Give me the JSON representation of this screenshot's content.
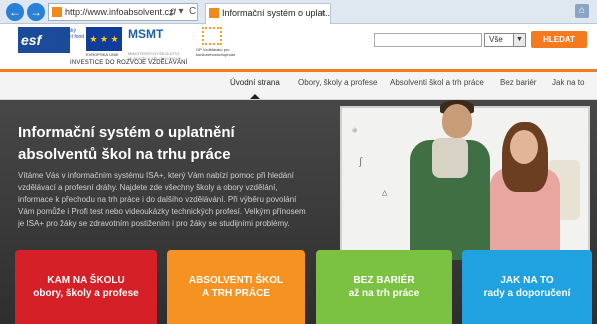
{
  "browser": {
    "back_icon": "arrow-left-icon",
    "forward_icon": "arrow-right-icon",
    "url": "http://www.infoabsolvent.cz/",
    "url_tools": "ρ ▾  C",
    "tab_title": "Informační systém o uplat...",
    "tab_close": "×",
    "home_icon": "⌂"
  },
  "header": {
    "esf_logo": "esf",
    "esf_text": "evropský sociální fond v ČR",
    "eu_text": "EVROPSKÁ UNIE",
    "msmt_logo": "MSMT",
    "msmt_text": "MINISTERSTVO ŠKOLSTVÍ, MLÁDEŽE A TĚLOVÝCHOVY",
    "oppa_text": "OP Vzdělávání pro konkurenceschopnost",
    "tagline": "INVESTICE DO ROZVOJE VZDĚLÁVÁNÍ",
    "search_value": "",
    "search_scope": "Vše",
    "search_button": "HLEDAT"
  },
  "nav": {
    "items": [
      {
        "label": "Úvodní strana",
        "active": true
      },
      {
        "label": "Obory, školy a profese"
      },
      {
        "label": "Absolventi škol a trh práce"
      },
      {
        "label": "Bez bariér"
      },
      {
        "label": "Jak na to"
      }
    ]
  },
  "hero": {
    "title": "Informační systém o uplatnění absolventů škol na trhu práce",
    "text": "Vítáme Vás v informačním systému ISA+, který Vám nabízí pomoc při hledání vzdělávací a profesní dráhy. Najdete zde všechny školy a obory vzdělání, informace k přechodu na trh práce i do dalšího vzdělávání. Při výběru povolání Vám pomůže i Profi test nebo videoukázky technických profesí. Velkým přínosem je ISA+ pro žáky se zdravotním postižením i pro žáky se studijními problémy."
  },
  "tiles": [
    {
      "line1": "KAM NA ŠKOLU",
      "line2": "obory, školy a profese",
      "color": "#d52027"
    },
    {
      "line1": "ABSOLVENTI ŠKOL",
      "line2": "A TRH PRÁCE",
      "color": "#f59221"
    },
    {
      "line1": "BEZ BARIÉR",
      "line2": "až na trh práce",
      "color": "#7cc242"
    },
    {
      "line1": "JAK NA TO",
      "line2": "rady a doporučení",
      "color": "#1fa2df"
    }
  ],
  "colors": {
    "accent": "#f47a1f",
    "hero_bg": "#3a3a3a"
  }
}
